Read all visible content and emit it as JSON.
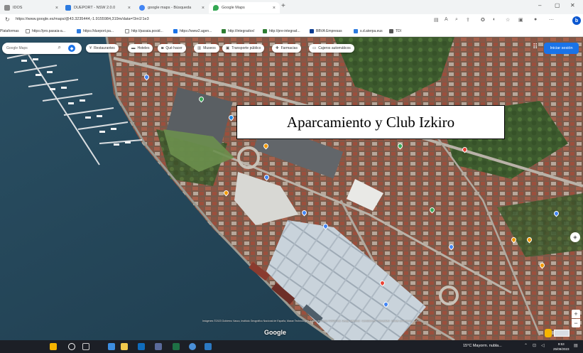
{
  "browser": {
    "tabs": [
      {
        "label": "IDOS",
        "favicon_color": "#8a8a8a"
      },
      {
        "label": "DUEPORT - NSW 2.0.0",
        "favicon_color": "#2d7be0"
      },
      {
        "label": "google maps - Búsqueda",
        "favicon_color": "#4285f4"
      },
      {
        "label": "Google Maps",
        "favicon_color": "#34a853",
        "active": true
      }
    ],
    "new_tab_label": "+",
    "window_controls": {
      "minimize": "–",
      "maximize": "▢",
      "close": "✕"
    },
    "url": "https://www.google.es/maps/@43.3235444,-1.9155984,319m/data=!3m1!1e3",
    "bookmarks": [
      {
        "label": "Plataformas",
        "color": "#888888"
      },
      {
        "label": "https://pro.pasaia-a...",
        "color": "#888888"
      },
      {
        "label": "https://dueport.pa...",
        "color": "#2d7be0"
      },
      {
        "label": "http://pasaia.posid...",
        "color": "#888888"
      },
      {
        "label": "https://www2.agen...",
        "color": "#1a73e8"
      },
      {
        "label": "http://integradox/",
        "color": "#2e7d32"
      },
      {
        "label": "http://pre-integrad...",
        "color": "#2e7d32"
      },
      {
        "label": "BBVA Empresas",
        "color": "#0b3d91"
      },
      {
        "label": "s.d.aterpa.eus",
        "color": "#2d7be0"
      },
      {
        "label": "TDI",
        "color": "#555555"
      }
    ],
    "profile_initial": "b"
  },
  "map": {
    "search_placeholder": "Google Maps",
    "chips": [
      {
        "label": "Restaurantes",
        "icon": "fork-icon"
      },
      {
        "label": "Hoteles",
        "icon": "bed-icon"
      },
      {
        "label": "Qué hacer",
        "icon": "camera-icon"
      },
      {
        "label": "Museos",
        "icon": "museum-icon"
      },
      {
        "label": "Transporte público",
        "icon": "bus-icon"
      },
      {
        "label": "Farmacias",
        "icon": "pharmacy-icon"
      },
      {
        "label": "Cajeros automáticos",
        "icon": "atm-icon"
      }
    ],
    "signin_label": "Iniciar sesión",
    "callout": "Aparcamiento y Club Izkiro",
    "google_logo": "Google",
    "attribution": "Imágenes ©2023 Gobierno Vasco, Instituto Geográfico Nacional de España, Maxar Technologies, Datos del mapa ©2023 Inst. Geogr. Nacional · Condiciones · Privacidad · Enviar comentarios · 20 m",
    "zoom_in": "+",
    "zoom_out": "−"
  },
  "taskbar": {
    "weather": "15°C Mayorm. nubla...",
    "time": "9:53",
    "date": "25/09/2023"
  }
}
